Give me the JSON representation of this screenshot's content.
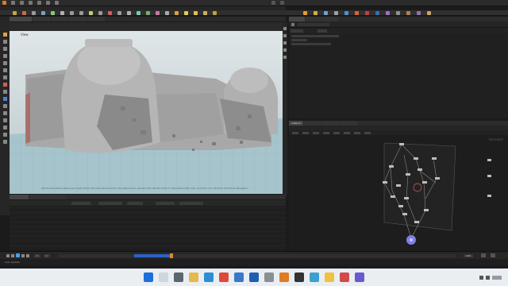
{
  "app": {
    "name": "Houdini"
  },
  "viewport": {
    "label": "View",
    "footer_note": "Left mouse tumbles. Middle pans. Right dollies. Ctrl+Alt+Left box-zooms. Ctrl+Right zooms. Spacebar-Ctrl-Left tilts. Hold L for alternate tumble, dolly, and zoom. M or Alt+M for First Person Navigation."
  },
  "network_editor": {
    "tab_label": "network",
    "node_label": "Backwall"
  },
  "timeline": {
    "current_frame": "1",
    "start_frame": "1",
    "end_frame": "240",
    "status": "Auto Update"
  },
  "colors": {
    "accent_orange": "#d98a2a",
    "node_selected": "#7f7fe8",
    "timeline_blue": "#2e62c7",
    "viewport_sky": "#c8d0d3",
    "viewport_ground": "#a6c4cc"
  },
  "taskbar": {
    "icons": [
      "windows-icon",
      "search-icon",
      "taskview-icon",
      "explorer-icon",
      "edge-icon",
      "chrome-icon",
      "store-icon",
      "mail-icon",
      "settings-icon",
      "houdini-icon",
      "terminal-icon",
      "photos-icon",
      "files-icon",
      "media-icon",
      "app-icon"
    ]
  }
}
